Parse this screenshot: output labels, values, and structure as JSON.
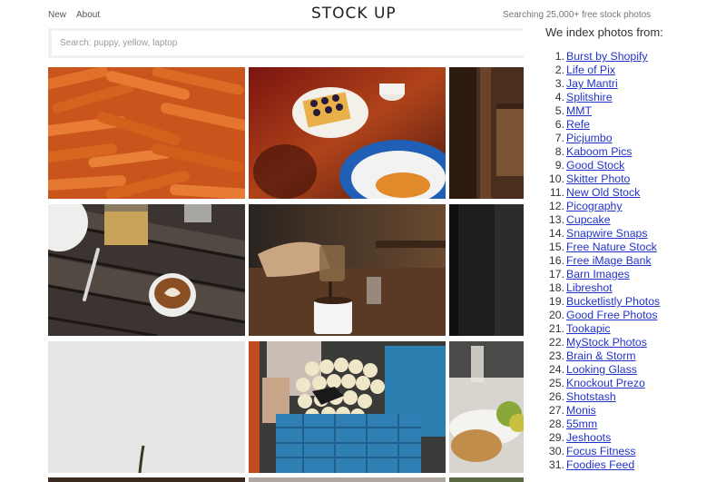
{
  "header": {
    "nav": [
      "New",
      "About"
    ],
    "logo": "STOCK UP",
    "tagline": "Searching 25,000+ free stock photos"
  },
  "search": {
    "placeholder": "Search: puppy, yellow, laptop"
  },
  "sidebar": {
    "title": "We index photos from:",
    "sources": [
      "Burst by Shopify",
      "Life of Pix",
      "Jay Mantri",
      "Splitshire",
      "MMT",
      "Refe",
      "Picjumbo",
      "Kaboom Pics",
      "Good Stock",
      "Skitter Photo",
      "New Old Stock",
      "Picography",
      "Cupcake",
      "Snapwire Snaps",
      "Free Nature Stock",
      "Free iMage Bank",
      "Barn Images",
      "Libreshot",
      "Bucketlistly Photos",
      "Good Free Photos",
      "Tookapic",
      "MyStock Photos",
      "Brain & Storm",
      "Looking Glass",
      "Knockout Prezo",
      "Shotstash",
      "Monis",
      "55mm",
      "Jeshoots",
      "Focus Fitness",
      "Foodies Feed"
    ]
  },
  "photos": [
    {
      "subject": "carrots"
    },
    {
      "subject": "waffle-and-coffee"
    },
    {
      "subject": "wooden-interior"
    },
    {
      "subject": "latte-on-wooden-table"
    },
    {
      "subject": "pouring-coffee"
    },
    {
      "subject": "dark-interior"
    },
    {
      "subject": "white-wall-plant"
    },
    {
      "subject": "onions-in-crate"
    },
    {
      "subject": "table-setting"
    }
  ],
  "colors": {
    "link": "#2233c9",
    "search_bg": "#f1f1f1"
  }
}
